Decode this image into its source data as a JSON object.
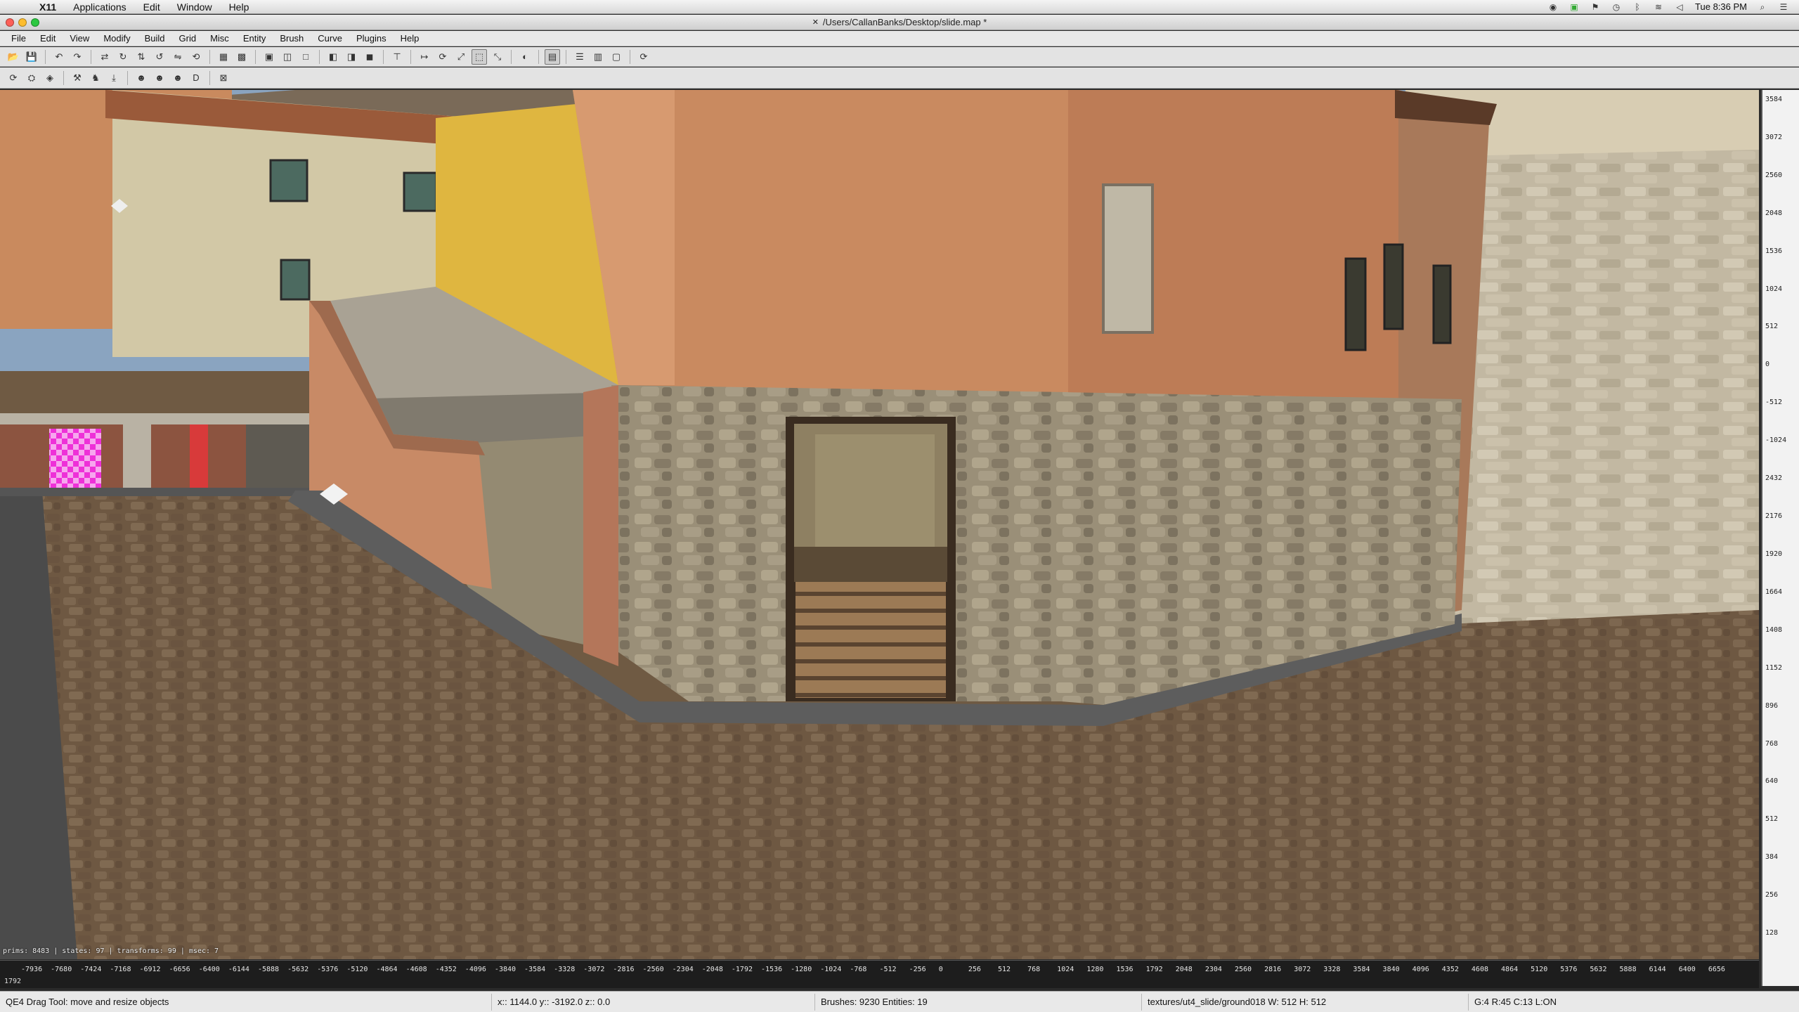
{
  "mac_menubar": {
    "app_name": "X11",
    "items": [
      "Applications",
      "Edit",
      "Window",
      "Help"
    ],
    "clock": "Tue 8:36 PM"
  },
  "window": {
    "title": "/Users/CallanBanks/Desktop/slide.map *"
  },
  "app_menu": [
    "File",
    "Edit",
    "View",
    "Modify",
    "Build",
    "Grid",
    "Misc",
    "Entity",
    "Brush",
    "Curve",
    "Plugins",
    "Help"
  ],
  "toolbar1": [
    {
      "icon": "open-icon",
      "glyph": "📂"
    },
    {
      "icon": "save-icon",
      "glyph": "💾"
    },
    {
      "sep": true
    },
    {
      "icon": "undo-icon",
      "glyph": "↶"
    },
    {
      "icon": "redo-icon",
      "glyph": "↷"
    },
    {
      "sep": true
    },
    {
      "icon": "flip-x-icon",
      "glyph": "⇄"
    },
    {
      "icon": "rotate-x-icon",
      "glyph": "↻"
    },
    {
      "icon": "flip-y-icon",
      "glyph": "⇅"
    },
    {
      "icon": "rotate-y-icon",
      "glyph": "↺"
    },
    {
      "icon": "flip-z-icon",
      "glyph": "⇋"
    },
    {
      "icon": "rotate-z-icon",
      "glyph": "⟲"
    },
    {
      "sep": true
    },
    {
      "icon": "select-inside-icon",
      "glyph": "▦"
    },
    {
      "icon": "select-touching-icon",
      "glyph": "▩"
    },
    {
      "sep": true
    },
    {
      "icon": "view-xy-icon",
      "glyph": "▣"
    },
    {
      "icon": "view-change-icon",
      "glyph": "◫"
    },
    {
      "icon": "view-single-icon",
      "glyph": "□"
    },
    {
      "sep": true
    },
    {
      "icon": "csg-subtract-icon",
      "glyph": "◧"
    },
    {
      "icon": "csg-merge-icon",
      "glyph": "◨"
    },
    {
      "icon": "hollow-icon",
      "glyph": "◼"
    },
    {
      "sep": true
    },
    {
      "icon": "clipper-icon",
      "glyph": "⊤"
    },
    {
      "sep": true
    },
    {
      "icon": "translate-icon",
      "glyph": "↦"
    },
    {
      "icon": "rotate-icon",
      "glyph": "⟳"
    },
    {
      "icon": "scale-icon",
      "glyph": "⤢"
    },
    {
      "icon": "drag-tool-icon",
      "glyph": "⬚",
      "active": true
    },
    {
      "icon": "resize-icon",
      "glyph": "⤡"
    },
    {
      "sep": true
    },
    {
      "icon": "patch-icon",
      "glyph": "◐"
    },
    {
      "sep": true
    },
    {
      "icon": "texture-lock-icon",
      "glyph": "▤",
      "active": true
    },
    {
      "sep": true
    },
    {
      "icon": "entity-list-icon",
      "glyph": "☰"
    },
    {
      "icon": "surface-inspector-icon",
      "glyph": "▥"
    },
    {
      "icon": "view-z-icon",
      "glyph": "▢"
    },
    {
      "sep": true
    },
    {
      "icon": "refresh-icon",
      "glyph": "⟳"
    }
  ],
  "toolbar2": [
    {
      "icon": "plugin-refresh-icon",
      "glyph": "⟳"
    },
    {
      "icon": "plugin-prefab-icon",
      "glyph": "⛭"
    },
    {
      "icon": "plugin-shader-icon",
      "glyph": "◈"
    },
    {
      "sep": true
    },
    {
      "icon": "plugin-bobtoolz-icon",
      "glyph": "⚒"
    },
    {
      "icon": "plugin-model-icon",
      "glyph": "♞"
    },
    {
      "icon": "plugin-drop-icon",
      "glyph": "⤓"
    },
    {
      "sep": true
    },
    {
      "icon": "plugin-cat-1-icon",
      "glyph": "☻"
    },
    {
      "icon": "plugin-cat-2-icon",
      "glyph": "☻"
    },
    {
      "icon": "plugin-cat-3-icon",
      "glyph": "☻"
    },
    {
      "icon": "plugin-d-icon",
      "glyph": "D"
    },
    {
      "sep": true
    },
    {
      "icon": "plugin-cancel-icon",
      "glyph": "⊠"
    }
  ],
  "viewport": {
    "stats": "prims: 8483 | states: 97 | transforms: 99 | msec: 7"
  },
  "zview_labels": [
    "3584",
    "3072",
    "2560",
    "2048",
    "1536",
    "1024",
    "512",
    "0",
    "-512",
    "-1024",
    "2432",
    "2176",
    "1920",
    "1664",
    "1408",
    "1152",
    "896",
    "768",
    "640",
    "512",
    "384",
    "256",
    "128"
  ],
  "ruler": {
    "ticks": [
      "-7936",
      "-7680",
      "-7424",
      "-7168",
      "-6912",
      "-6656",
      "-6400",
      "-6144",
      "-5888",
      "-5632",
      "-5376",
      "-5120",
      "-4864",
      "-4608",
      "-4352",
      "-4096",
      "-3840",
      "-3584",
      "-3328",
      "-3072",
      "-2816",
      "-2560",
      "-2304",
      "-2048",
      "-1792",
      "-1536",
      "-1280",
      "-1024",
      "-768",
      "-512",
      "-256",
      "0",
      "256",
      "512",
      "768",
      "1024",
      "1280",
      "1536",
      "1792",
      "2048",
      "2304",
      "2560",
      "2816",
      "3072",
      "3328",
      "3584",
      "3840",
      "4096",
      "4352",
      "4608",
      "4864",
      "5120",
      "5376",
      "5632",
      "5888",
      "6144",
      "6400",
      "6656"
    ],
    "corner_label": "1792"
  },
  "statusbar": {
    "tool": "QE4 Drag Tool: move and resize objects",
    "coords": "x:: 1144.0  y:: -3192.0  z::    0.0",
    "counts": "Brushes: 9230 Entities: 19",
    "texture": "textures/ut4_slide/ground018 W: 512 H: 512",
    "grid": "G:4  R:45  C:13  L:ON"
  },
  "colors": {
    "cobble": "#6f5a43",
    "plaster_orange": "#c98a60",
    "stone_wall": "#a29780",
    "yellow_building": "#dfb640",
    "magenta_texture": "#e020d0"
  }
}
